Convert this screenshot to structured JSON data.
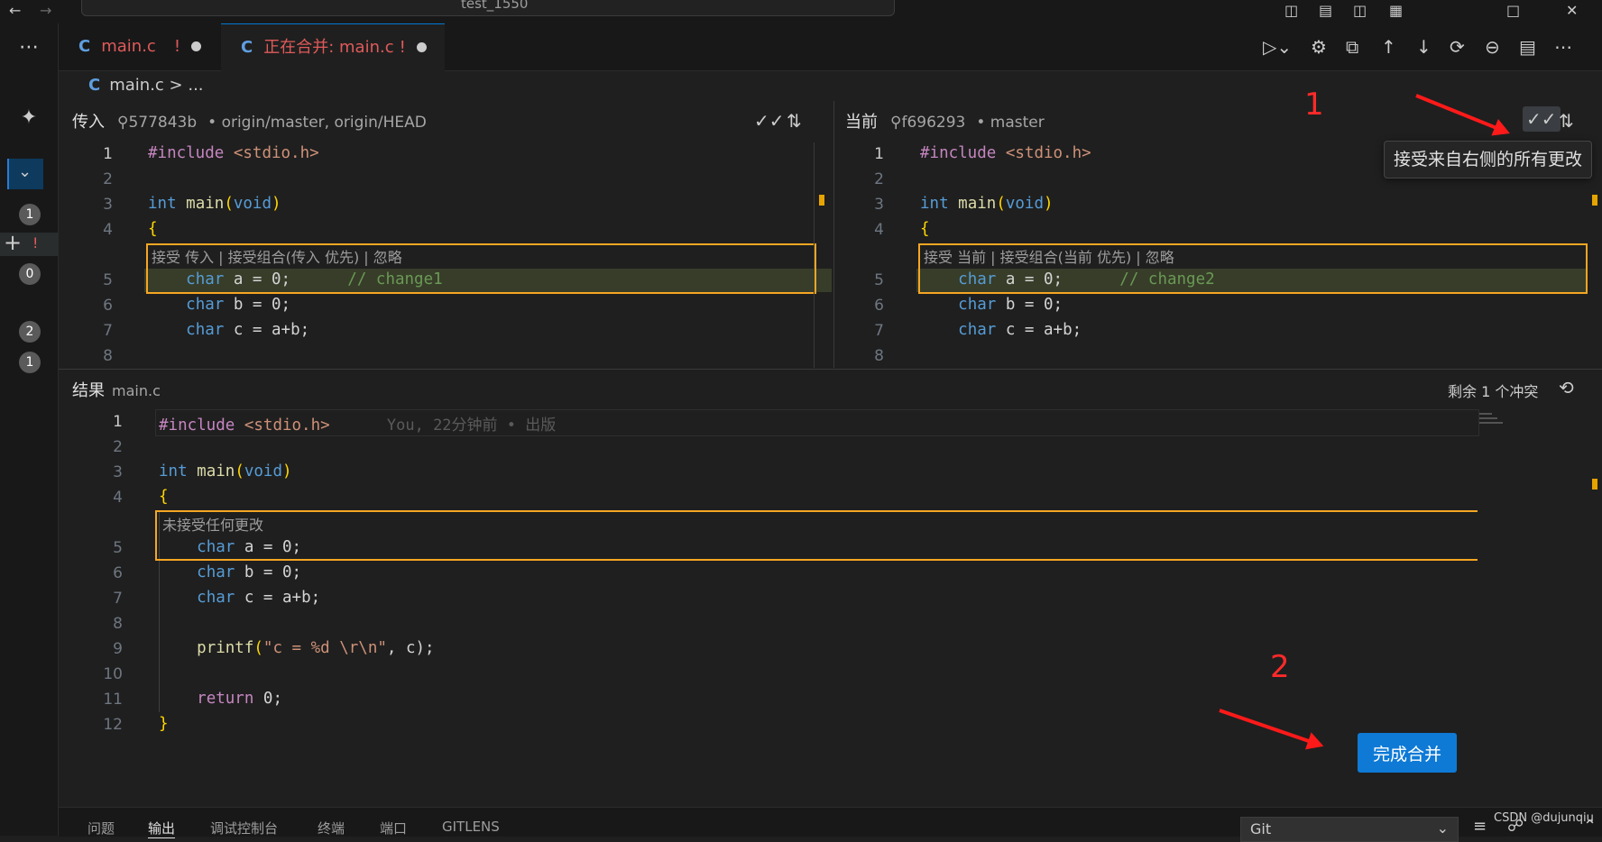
{
  "window": {
    "search_text": "test_1550"
  },
  "tabs": [
    {
      "icon": "C",
      "label": "main.c",
      "flag": "!"
    },
    {
      "icon": "C",
      "label": "正在合并: main.c",
      "flag": "!"
    }
  ],
  "breadcrumb": {
    "icon": "C",
    "file": "main.c",
    "rest": "> ..."
  },
  "incoming": {
    "title": "传入",
    "commit": "577843b",
    "refs": "• origin/master, origin/HEAD",
    "codelens": "接受 传入 | 接受组合(传入 优先) | 忽略",
    "change_comment": "// change1"
  },
  "current": {
    "title": "当前",
    "commit": "f696293",
    "refs": "• master",
    "codelens": "接受 当前 | 接受组合(当前 优先) | 忽略",
    "change_comment": "// change2"
  },
  "code": {
    "include_kw": "#include",
    "include_file": "<stdio.h>",
    "int_kw": "int",
    "main_fn": "main",
    "void_kw": "void",
    "open_brace": "{",
    "close_brace": "}",
    "char_kw": "char",
    "line_a": "a = 0;",
    "line_b": "b = 0;",
    "line_c": "c = a+b;",
    "printf_fn": "printf",
    "printf_str": "\"c = %d \\r\\n\"",
    "printf_tail": ", c);",
    "return_kw": "return",
    "return_tail": "0;"
  },
  "side_line_numbers": [
    "1",
    "2",
    "3",
    "4",
    "5",
    "6",
    "7",
    "8"
  ],
  "result": {
    "title": "结果",
    "file": "main.c",
    "remaining": "剩余 1 个冲突",
    "blame": "You, 22分钟前 • 出版",
    "codelens": "未接受任何更改",
    "line_numbers": [
      "1",
      "2",
      "3",
      "4",
      "5",
      "6",
      "7",
      "8",
      "9",
      "10",
      "11",
      "12"
    ]
  },
  "tooltip": "接受来自右侧的所有更改",
  "complete_button": "完成合并",
  "annotations": {
    "one": "1",
    "two": "2"
  },
  "activity_counts": [
    "1",
    "!",
    "0",
    "2",
    "1"
  ],
  "panel": {
    "tabs": [
      "问题",
      "输出",
      "调试控制台",
      "终端",
      "端口",
      "GITLENS"
    ],
    "active_tab": "输出",
    "output_channel": "Git"
  },
  "watermark": "CSDN @dujunqiu"
}
